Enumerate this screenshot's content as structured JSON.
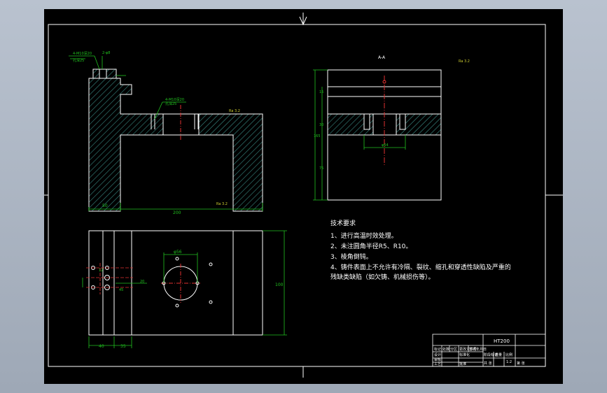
{
  "colors": {
    "paper": "#000000",
    "frame": "#ffffff",
    "hatch": "#3a8c86",
    "dimension": "#21c21f",
    "centerline": "#e13030",
    "surface_mark": "#cfcf30"
  },
  "views": {
    "section_label": "A-A",
    "roughness_general": "Ra 3.2",
    "roughness_local": "Ra 3.2",
    "roughness_bottom": "Ra 3.2",
    "front_note_1": "4-M10深20",
    "front_note_2": "孔深25",
    "front_note_3": "4-M10深20",
    "front_note_4": "孔深25",
    "dim_top_note": "2-φ8",
    "dim_front_width": "200",
    "dim_front_left": "50",
    "dim_side_height": "165",
    "dim_side_a": "15",
    "dim_side_b": "30",
    "dim_side_c": "75",
    "dim_side_hole": "φ64",
    "dim_plan_height": "100",
    "dim_plan_left": "40",
    "dim_plan_mid": "35",
    "dim_plan_hole": "φ56",
    "dim_plan_a": "20",
    "dim_plan_b": "12",
    "dim_plan_c": "45"
  },
  "requirements": {
    "heading": "技术要求",
    "items": [
      "1、进行高温时效处理。",
      "2、未注圆角半径R5、R10。",
      "3、棱角倒钝。",
      "4、铸件表面上不允许有冷隔、裂纹、缩孔和穿透性缺陷及严重的",
      "残缺类缺陷（如欠铸、机械损伤等）。"
    ]
  },
  "title_block": {
    "material": "HT200",
    "sign_label": "标记",
    "count_label": "处数",
    "zone_label": "分区",
    "change_label": "更改文件号",
    "signature_label": "签名",
    "date_label": "年月日",
    "design_label": "设计",
    "standard_label": "标准化",
    "review_label": "审核",
    "process_label": "工艺",
    "approve_label": "批准",
    "stage_label": "阶段标记",
    "weight_label": "重量",
    "scale_label": "比例",
    "scale_value": "1:2",
    "sheet_total": "共 张",
    "sheet_no": "第 张"
  }
}
